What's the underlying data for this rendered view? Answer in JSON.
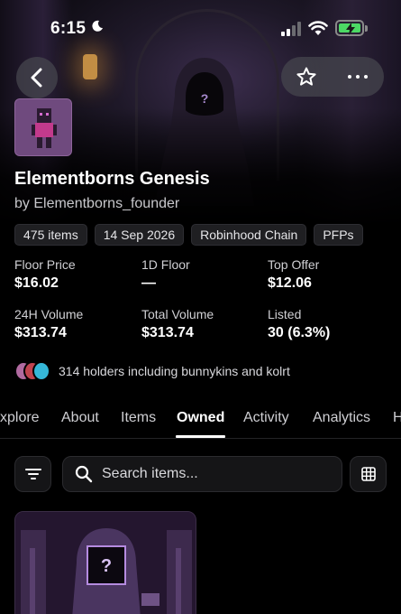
{
  "status_bar": {
    "time": "6:15"
  },
  "collection": {
    "title": "Elementborns Genesis",
    "creator": "by Elementborns_founder",
    "tags": [
      "475 items",
      "14 Sep 2026",
      "Robinhood Chain",
      "PFPs"
    ]
  },
  "stats": [
    {
      "label": "Floor Price",
      "value": "$16.02"
    },
    {
      "label": "1D Floor",
      "value": "—"
    },
    {
      "label": "Top Offer",
      "value": "$12.06"
    },
    {
      "label": "24H Volume",
      "value": "$313.74"
    },
    {
      "label": "Total Volume",
      "value": "$313.74"
    },
    {
      "label": "Listed",
      "value": "30 (6.3%)"
    }
  ],
  "holders": {
    "text": "314 holders including bunnykins and kolrt"
  },
  "tabs": [
    "xplore",
    "About",
    "Items",
    "Owned",
    "Activity",
    "Analytics",
    "H"
  ],
  "active_tab": "Owned",
  "search": {
    "placeholder": "Search items..."
  },
  "icons": [
    "moon-icon",
    "signal-icon",
    "wifi-icon",
    "battery-icon",
    "back-arrow-icon",
    "star-icon",
    "more-icon",
    "filter-icon",
    "search-icon",
    "grid-icon"
  ],
  "colors": {
    "background": "#000000",
    "battery_green": "#4cd964",
    "avatar_purple": "#7b4b8a"
  }
}
